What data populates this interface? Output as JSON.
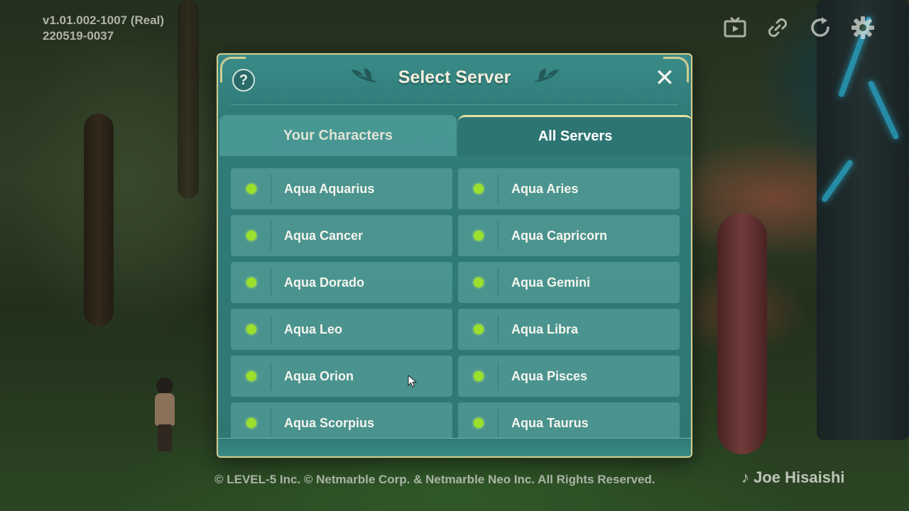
{
  "version": {
    "line1": "v1.01.002-1007 (Real)",
    "line2": "220519-0037"
  },
  "top_icons": [
    "tv-icon",
    "link-icon",
    "refresh-icon",
    "gear-icon"
  ],
  "dialog": {
    "title": "Select Server",
    "help_label": "?",
    "close_label": "✕",
    "tabs": [
      {
        "label": "Your Characters",
        "active": false
      },
      {
        "label": "All Servers",
        "active": true
      }
    ],
    "servers": [
      {
        "name": "Aqua Aquarius",
        "status_color": "#9be02c"
      },
      {
        "name": "Aqua Aries",
        "status_color": "#9be02c"
      },
      {
        "name": "Aqua Cancer",
        "status_color": "#9be02c"
      },
      {
        "name": "Aqua Capricorn",
        "status_color": "#9be02c"
      },
      {
        "name": "Aqua Dorado",
        "status_color": "#9be02c"
      },
      {
        "name": "Aqua Gemini",
        "status_color": "#9be02c"
      },
      {
        "name": "Aqua Leo",
        "status_color": "#9be02c"
      },
      {
        "name": "Aqua Libra",
        "status_color": "#9be02c"
      },
      {
        "name": "Aqua Orion",
        "status_color": "#9be02c"
      },
      {
        "name": "Aqua Pisces",
        "status_color": "#9be02c"
      },
      {
        "name": "Aqua Scorpius",
        "status_color": "#9be02c"
      },
      {
        "name": "Aqua Taurus",
        "status_color": "#9be02c"
      }
    ]
  },
  "footer": {
    "copyright": "© LEVEL-5 Inc. © Netmarble Corp. & Netmarble Neo Inc. All Rights Reserved.",
    "music_credit": "♪ Joe Hisaishi"
  },
  "colors": {
    "panel": "#2e7774",
    "accent_gold": "#d8cf8c",
    "online": "#9be02c"
  }
}
